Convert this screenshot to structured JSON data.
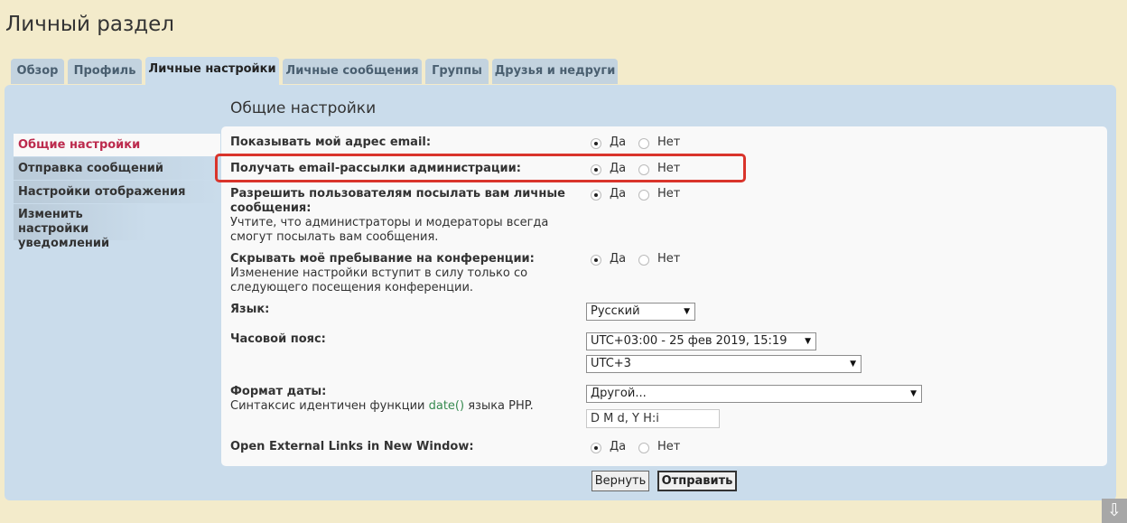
{
  "page": {
    "title": "Личный раздел"
  },
  "tabs": [
    {
      "label": "Обзор"
    },
    {
      "label": "Профиль"
    },
    {
      "label": "Личные настройки"
    },
    {
      "label": "Личные сообщения"
    },
    {
      "label": "Группы"
    },
    {
      "label": "Друзья и недруги"
    }
  ],
  "sidebar": {
    "items": [
      {
        "label": "Общие настройки"
      },
      {
        "label": "Отправка сообщений"
      },
      {
        "label": "Настройки отображения"
      },
      {
        "label": "Изменить настройки уведомлений"
      }
    ]
  },
  "section": {
    "title": "Общие настройки"
  },
  "options": {
    "yes": "Да",
    "no": "Нет",
    "show_email": {
      "label": "Показывать мой адрес email:",
      "value": "Да"
    },
    "admin_mail": {
      "label": "Получать email-рассылки администрации:",
      "value": "Да"
    },
    "allow_pm": {
      "label": "Разрешить пользователям посылать вам личные сообщения:",
      "hint": "Учтите, что администраторы и модераторы всегда смогут посылать вам сообщения.",
      "value": "Да"
    },
    "hide_online": {
      "label": "Скрывать моё пребывание на конференции:",
      "hint": "Изменение настройки вступит в силу только со следующего посещения конференции.",
      "value": "Да"
    },
    "language": {
      "label": "Язык:",
      "value": "Русский"
    },
    "timezone": {
      "label": "Часовой пояс:",
      "date_value": "UTC+03:00 - 25 фев 2019, 15:19",
      "zone_value": "UTC+3"
    },
    "date_format": {
      "label": "Формат даты:",
      "hint_before": "Синтаксис идентичен функции ",
      "hint_code": "date()",
      "hint_after": " языка PHP.",
      "value": "Другой...",
      "custom": "D M d, Y H:i"
    },
    "external_links": {
      "label": "Open External Links in New Window:",
      "value": "Да"
    }
  },
  "buttons": {
    "reset": "Вернуть",
    "submit": "Отправить"
  },
  "scroll_button": {
    "glyph": "⇩"
  },
  "colors": {
    "accent_active": "#bc2a4d",
    "highlight": "#d9342b",
    "background": "#f3ebcb",
    "panel": "#cadceb"
  }
}
